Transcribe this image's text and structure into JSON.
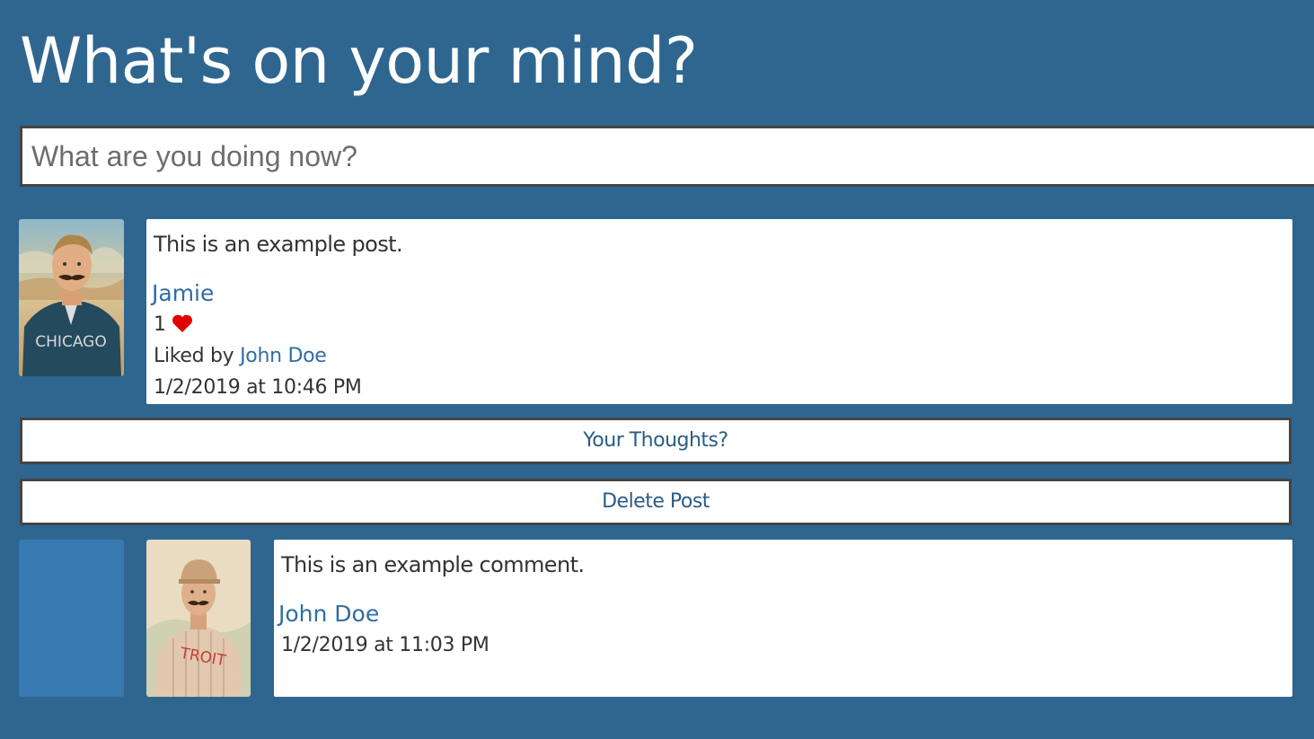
{
  "page": {
    "title": "What's on your mind?"
  },
  "status_input": {
    "placeholder": "What are you doing now?",
    "value": ""
  },
  "post": {
    "text": "This is an example post.",
    "author": "Jamie",
    "likes_count": "1",
    "liked_by_prefix": "Liked by",
    "liked_by_user": "John Doe",
    "timestamp": "1/2/2019 at 10:46 PM",
    "avatar_caption": "CHICAGO"
  },
  "actions": {
    "thoughts_label": "Your Thoughts?",
    "delete_label": "Delete Post"
  },
  "comment": {
    "text": "This is an example comment.",
    "author": "John Doe",
    "timestamp": "1/2/2019 at 11:03 PM",
    "avatar_caption": "TROIT"
  },
  "colors": {
    "background": "#2f6690",
    "link": "#2f6da3",
    "heart": "#e00000",
    "indent_block": "#3779b0"
  },
  "icons": {
    "like": "heart-icon"
  }
}
